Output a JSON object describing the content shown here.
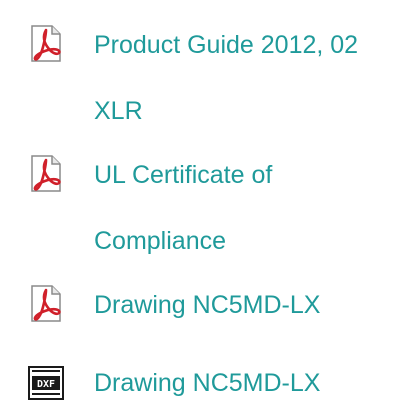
{
  "documents": [
    {
      "label": "Product Guide 2012, 02 XLR",
      "icon": "pdf-icon"
    },
    {
      "label": "UL Certificate of Compliance",
      "icon": "pdf-icon"
    },
    {
      "label": "Drawing NC5MD-LX",
      "icon": "pdf-icon"
    },
    {
      "label": "Drawing NC5MD-LX",
      "icon": "dxf-icon"
    }
  ],
  "icon_text": {
    "dxf": "DXF"
  },
  "colors": {
    "link": "#1f9a9a",
    "pdf_red": "#d0202a",
    "dxf_dark": "#1a1a1a"
  }
}
